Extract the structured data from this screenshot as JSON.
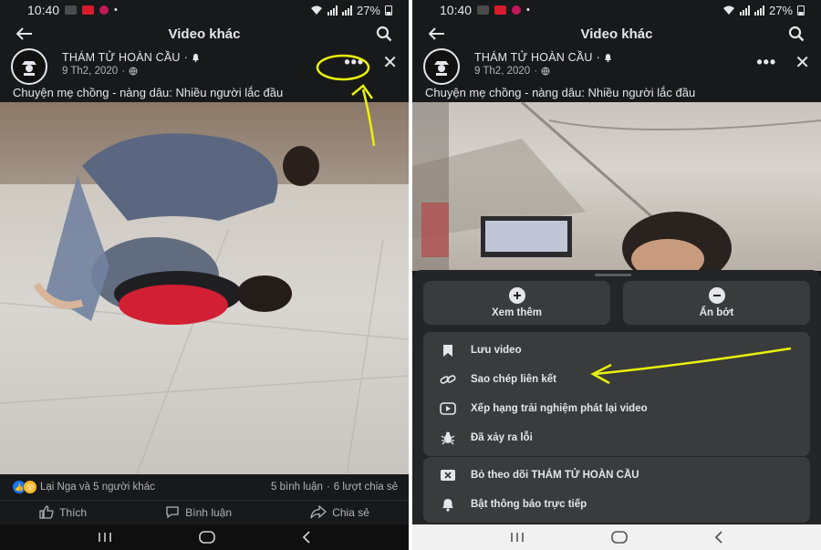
{
  "status": {
    "time": "10:40",
    "battery": "27%"
  },
  "topbar": {
    "title": "Video khác"
  },
  "post": {
    "author": "THÁM TỬ HOÀN CẦU",
    "date": "9 Th2, 2020",
    "separator": "·",
    "caption": "Chuyện mẹ chồng - nàng dâu: Nhiều người lắc đầu",
    "more_label": "•••",
    "close_label": "✕"
  },
  "reactions": {
    "summary": "Lại Nga và 5 người khác",
    "comments": "5 bình luận",
    "dot": "·",
    "shares": "6 lượt chia sẻ"
  },
  "actions": {
    "like": "Thích",
    "comment": "Bình luận",
    "share": "Chia sẻ"
  },
  "sheet": {
    "see_more": "Xem thêm",
    "hide": "Ẩn bớt",
    "items": [
      {
        "label": "Lưu video",
        "icon": "bookmark-icon"
      },
      {
        "label": "Sao chép liên kết",
        "icon": "link-icon"
      },
      {
        "label": "Xếp hạng trải nghiệm phát lại video",
        "icon": "video-rating-icon"
      },
      {
        "label": "Đã xảy ra lỗi",
        "icon": "bug-icon"
      }
    ],
    "unfollow": "Bỏ theo dõi THÁM TỬ HOÀN CẦU",
    "notify": "Bật thông báo trực tiếp"
  },
  "colors": {
    "background": "#18191a",
    "sheet": "#242526",
    "item": "#3a3b3c",
    "text": "#e4e6eb",
    "annotation": "#e8f20a"
  }
}
